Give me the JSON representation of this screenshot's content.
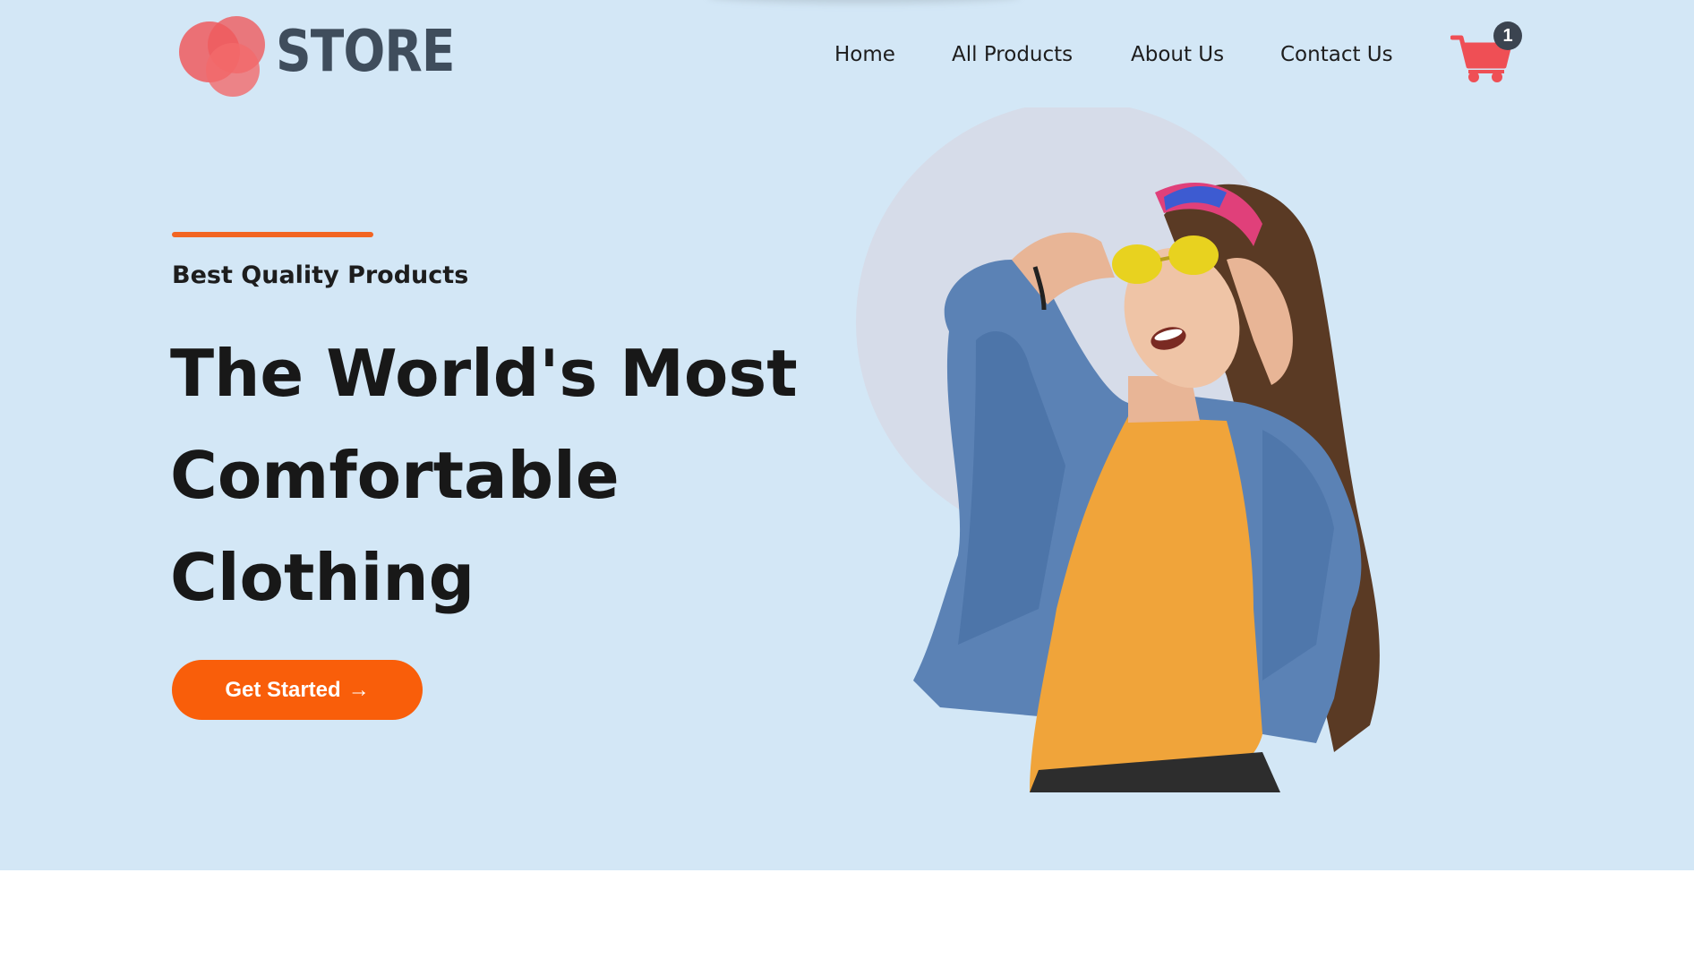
{
  "brand": {
    "name": "STORE",
    "accent_color": "#f26522",
    "logo_colors": [
      "#ef5b5e",
      "#f17a7c"
    ]
  },
  "nav": {
    "items": [
      {
        "label": "Home"
      },
      {
        "label": "All Products"
      },
      {
        "label": "About Us"
      },
      {
        "label": "Contact Us"
      }
    ],
    "cart_count": "1",
    "cart_icon": "shopping-cart-icon"
  },
  "hero": {
    "eyebrow": "Best Quality Products",
    "headline_lines": [
      "The World's Most",
      "Comfortable",
      "Clothing"
    ],
    "cta_label": "Get Started",
    "cta_arrow": "→",
    "image": "woman-in-denim-jacket-with-sunglasses",
    "background_color": "#d3e7f6"
  }
}
